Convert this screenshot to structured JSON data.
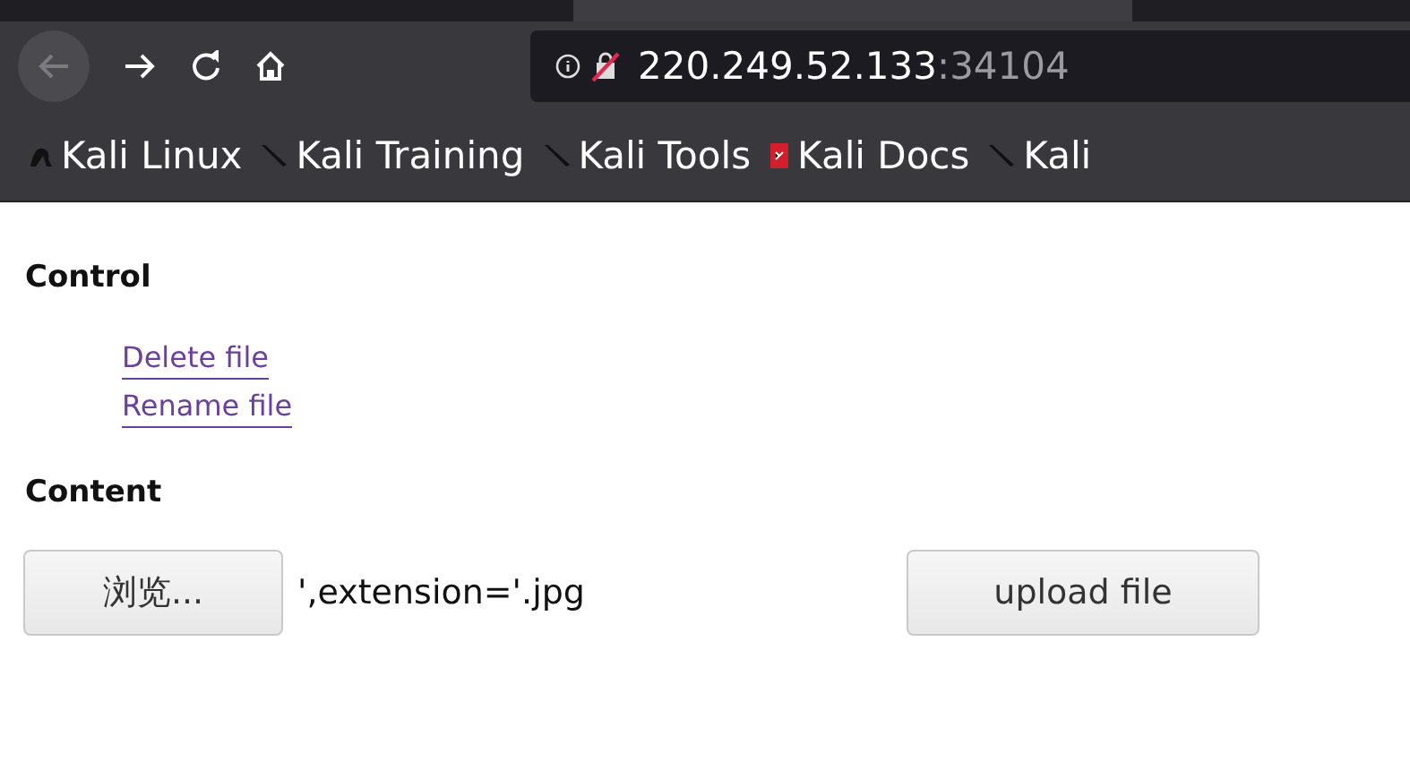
{
  "address_bar": {
    "host": "220.249.52.133",
    "port": ":34104"
  },
  "bookmarks": [
    {
      "label": "Kali Linux",
      "kind": "dragon"
    },
    {
      "label": "Kali Training",
      "kind": "blade"
    },
    {
      "label": "Kali Tools",
      "kind": "blade"
    },
    {
      "label": "Kali Docs",
      "kind": "doc"
    },
    {
      "label": "Kali",
      "kind": "blade"
    }
  ],
  "sections": [
    {
      "heading": "Control",
      "links": [
        "Delete file",
        "Rename file"
      ]
    },
    {
      "heading": "Content"
    }
  ],
  "upload": {
    "browse_button": "浏览...",
    "file_name": "',extension='.jpg",
    "submit_button": "upload file"
  }
}
